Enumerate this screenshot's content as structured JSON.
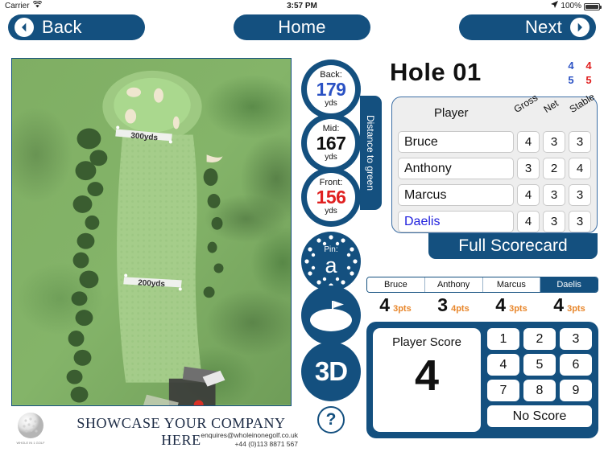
{
  "status_bar": {
    "carrier": "Carrier",
    "wifi_icon": "wifi-icon",
    "time": "3:57 PM",
    "location_icon": "location-arrow-icon",
    "battery_percent": "100%",
    "battery_icon": "battery-full-icon"
  },
  "top_nav": {
    "back_label": "Back",
    "home_label": "Home",
    "next_label": "Next",
    "back_icon": "chevron-left-icon",
    "next_icon": "chevron-right-icon",
    "button_color": "#14507f"
  },
  "map": {
    "yardage_markers": [
      "300yds",
      "200yds"
    ],
    "tee_markers": [
      "red",
      "yellow",
      "white"
    ]
  },
  "distances": {
    "tab_label": "Distance to green",
    "units": "yds",
    "back": {
      "label": "Back:",
      "value": "179",
      "units": "yds",
      "color": "#2b52c4"
    },
    "mid": {
      "label": "Mid:",
      "value": "167",
      "units": "yds",
      "color": "#111111"
    },
    "front": {
      "label": "Front:",
      "value": "156",
      "units": "yds",
      "color": "#e02020"
    }
  },
  "side_buttons": {
    "pin_label": "Pin:",
    "pin_value": "a",
    "green_icon": "green-flag-icon",
    "hole3d_label": "3D",
    "help_label": "?"
  },
  "hole": {
    "title": "Hole 01",
    "stats": [
      {
        "value": "4",
        "color": "blue"
      },
      {
        "value": "4",
        "color": "red"
      },
      {
        "value": "5",
        "color": "blue"
      },
      {
        "value": "5",
        "color": "red"
      }
    ]
  },
  "scorecard": {
    "headers": {
      "player": "Player",
      "gross": "Gross",
      "net": "Net",
      "stable": "Stable"
    },
    "rows": [
      {
        "name": "Bruce",
        "gross": "4",
        "net": "3",
        "stable": "3",
        "active": false
      },
      {
        "name": "Anthony",
        "gross": "3",
        "net": "2",
        "stable": "4",
        "active": false
      },
      {
        "name": "Marcus",
        "gross": "4",
        "net": "3",
        "stable": "3",
        "active": false
      },
      {
        "name": "Daelis",
        "gross": "4",
        "net": "3",
        "stable": "3",
        "active": true
      }
    ],
    "full_scorecard_label": "Full Scorecard"
  },
  "player_tabs": [
    {
      "name": "Bruce",
      "score": "4",
      "points": "3pts",
      "selected": false
    },
    {
      "name": "Anthony",
      "score": "3",
      "points": "4pts",
      "selected": false
    },
    {
      "name": "Marcus",
      "score": "4",
      "points": "3pts",
      "selected": false
    },
    {
      "name": "Daelis",
      "score": "4",
      "points": "3pts",
      "selected": true
    }
  ],
  "score_entry": {
    "label": "Player Score",
    "value": "4",
    "keys": [
      "1",
      "2",
      "3",
      "4",
      "5",
      "6",
      "7",
      "8",
      "9"
    ],
    "no_score_label": "No Score"
  },
  "advert": {
    "headline": "SHOWCASE YOUR COMPANY HERE",
    "email": "enquires@wholeinonegolf.co.uk",
    "phone": "+44 (0)113 8871 567",
    "logo_icon": "golf-ball-logo-icon"
  }
}
